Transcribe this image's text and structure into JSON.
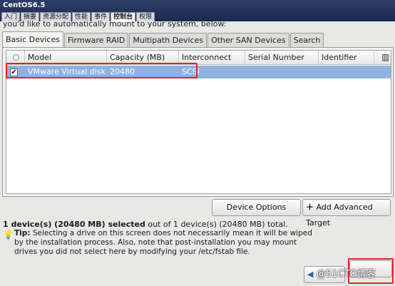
{
  "vm": {
    "title": "CentOS6.5",
    "tabs": [
      "入门",
      "摘要",
      "资源分配",
      "性能",
      "事件",
      "控制台",
      "权限"
    ],
    "active_tab_index": 5
  },
  "header": {
    "cut_text": "you'd like to automatically mount to your system, below:"
  },
  "notebook_tabs": [
    {
      "label": "Basic Devices",
      "active": true
    },
    {
      "label": "Firmware RAID",
      "active": false
    },
    {
      "label": "Multipath Devices",
      "active": false
    },
    {
      "label": "Other SAN Devices",
      "active": false
    },
    {
      "label": "Search",
      "active": false
    }
  ],
  "table": {
    "columns": [
      "",
      "Model",
      "Capacity (MB)",
      "Interconnect",
      "Serial Number",
      "Identifier"
    ],
    "rows": [
      {
        "checked": true,
        "model": "VMware Virtual disk",
        "capacity": "20480",
        "interconnect": "SCSI",
        "serial": "",
        "identifier": ""
      }
    ]
  },
  "buttons": {
    "device_options": "Device Options",
    "add_target": "Add Advanced Target",
    "back": "",
    "next": ""
  },
  "status": {
    "selected_bold": "1 device(s) (20480 MB) selected",
    "selected_rest": " out of 1 device(s) (20480 MB) total."
  },
  "tip": {
    "label": "Tip:",
    "text": " Selecting a drive on this screen does not necessarily mean it will be wiped by the installation process.  Also, note that post-installation you may mount drives you did not select here by modifying your /etc/fstab file."
  },
  "watermark": "@51CTO博客",
  "colors": {
    "selection": "#8fb2e0",
    "highlight_box": "#e02424"
  }
}
